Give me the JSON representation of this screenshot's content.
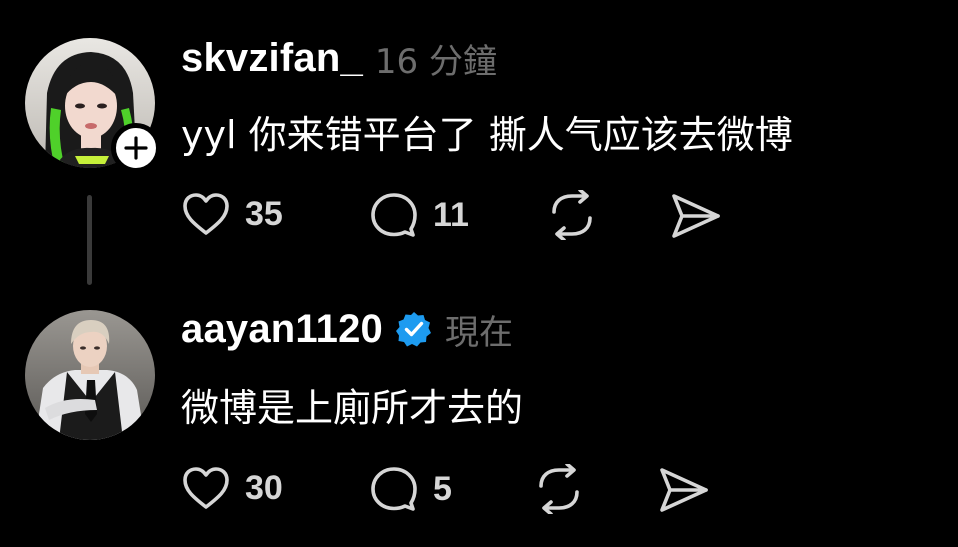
{
  "colors": {
    "background": "#000000",
    "text": "#ffffff",
    "muted": "#6d6d6d",
    "icon": "#d6d6d6",
    "verified": "#1d9bf0",
    "thread_line": "#3a3a3a"
  },
  "posts": [
    {
      "username": "skvzifan_",
      "timestamp": "16 分鐘",
      "text": "yyl 你来错平台了 撕人气应该去微博",
      "verified": false,
      "has_follow_badge": true,
      "avatar_icon": "user-avatar-green-hair",
      "likes": "35",
      "replies": "11"
    },
    {
      "username": "aayan1120",
      "timestamp": "現在",
      "text": "微博是上廁所才去的",
      "verified": true,
      "has_follow_badge": false,
      "avatar_icon": "user-avatar-suit",
      "likes": "30",
      "replies": "5"
    }
  ],
  "icons": {
    "like": "heart-icon",
    "reply": "speech-bubble-icon",
    "repost": "repost-arrows-icon",
    "share": "paper-plane-icon",
    "follow": "plus-icon",
    "verified": "verified-badge-icon"
  }
}
